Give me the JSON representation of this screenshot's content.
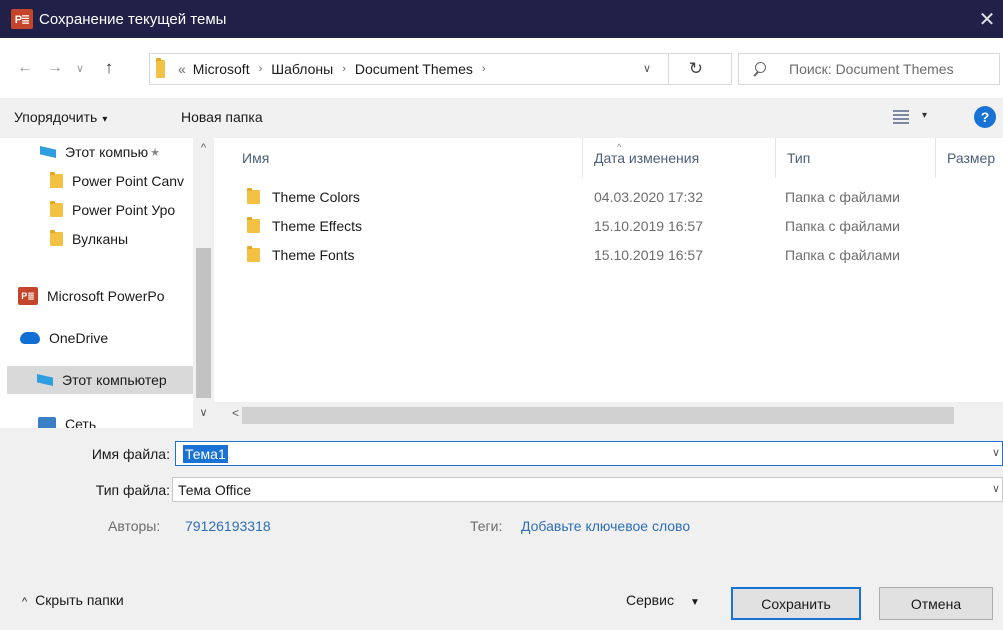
{
  "window": {
    "title": "Сохранение текущей темы",
    "app_logo": "P≣",
    "close_glyph": "✕"
  },
  "navigation": {
    "back_glyph": "←",
    "forward_glyph": "→",
    "history_glyph": "∨",
    "up_glyph": "↑",
    "breadcrumb_start": "«",
    "breadcrumbs": [
      "Microsoft",
      "Шаблоны",
      "Document Themes"
    ],
    "crumb_separator": "›",
    "dropdown_glyph": "∨",
    "refresh_glyph": "↻",
    "search_placeholder": "Поиск: Document Themes"
  },
  "toolbar": {
    "organize_label": "Упорядочить",
    "organize_caret": "▾",
    "new_folder_label": "Новая папка",
    "view_caret": "▾",
    "help_label": "?"
  },
  "nav_pane": {
    "up_glyph": "^",
    "down_glyph": "∨",
    "pin_glyph": "★",
    "items": [
      {
        "label": "Этот компью",
        "icon": "computer-icon"
      },
      {
        "label": "Power Point Canv",
        "icon": "folder-icon"
      },
      {
        "label": "Power Point Уро",
        "icon": "folder-icon"
      },
      {
        "label": "Вулканы",
        "icon": "folder-icon"
      },
      {
        "label": "Microsoft PowerPo",
        "icon": "powerpoint-icon"
      },
      {
        "label": "OneDrive",
        "icon": "onedrive-cloud-icon"
      },
      {
        "label": "Этот компьютер",
        "icon": "computer-icon"
      },
      {
        "label": "Сеть",
        "icon": "network-icon"
      }
    ],
    "powerpoint_glyph": "P≣"
  },
  "file_list": {
    "columns": [
      "Имя",
      "Дата изменения",
      "Тип",
      "Размер"
    ],
    "sort_glyph": "^",
    "rows": [
      {
        "name": "Theme Colors",
        "date": "04.03.2020 17:32",
        "type": "Папка с файлами"
      },
      {
        "name": "Theme Effects",
        "date": "15.10.2019 16:57",
        "type": "Папка с файлами"
      },
      {
        "name": "Theme Fonts",
        "date": "15.10.2019 16:57",
        "type": "Папка с файлами"
      }
    ],
    "scroll_left_glyph": "<"
  },
  "form": {
    "filename_label": "Имя файла:",
    "filename_value": "Тема1",
    "filetype_label": "Тип файла:",
    "filetype_value": "Тема Office",
    "dropdown_glyph": "∨",
    "authors_label": "Авторы:",
    "authors_value": "79126193318",
    "tags_label": "Теги:",
    "tags_value": "Добавьте ключевое слово"
  },
  "footer": {
    "hide_folders_caret": "^",
    "hide_folders_label": "Скрыть папки",
    "tools_label": "Сервис",
    "tools_caret": "▼",
    "save_label": "Сохранить",
    "cancel_label": "Отмена"
  }
}
